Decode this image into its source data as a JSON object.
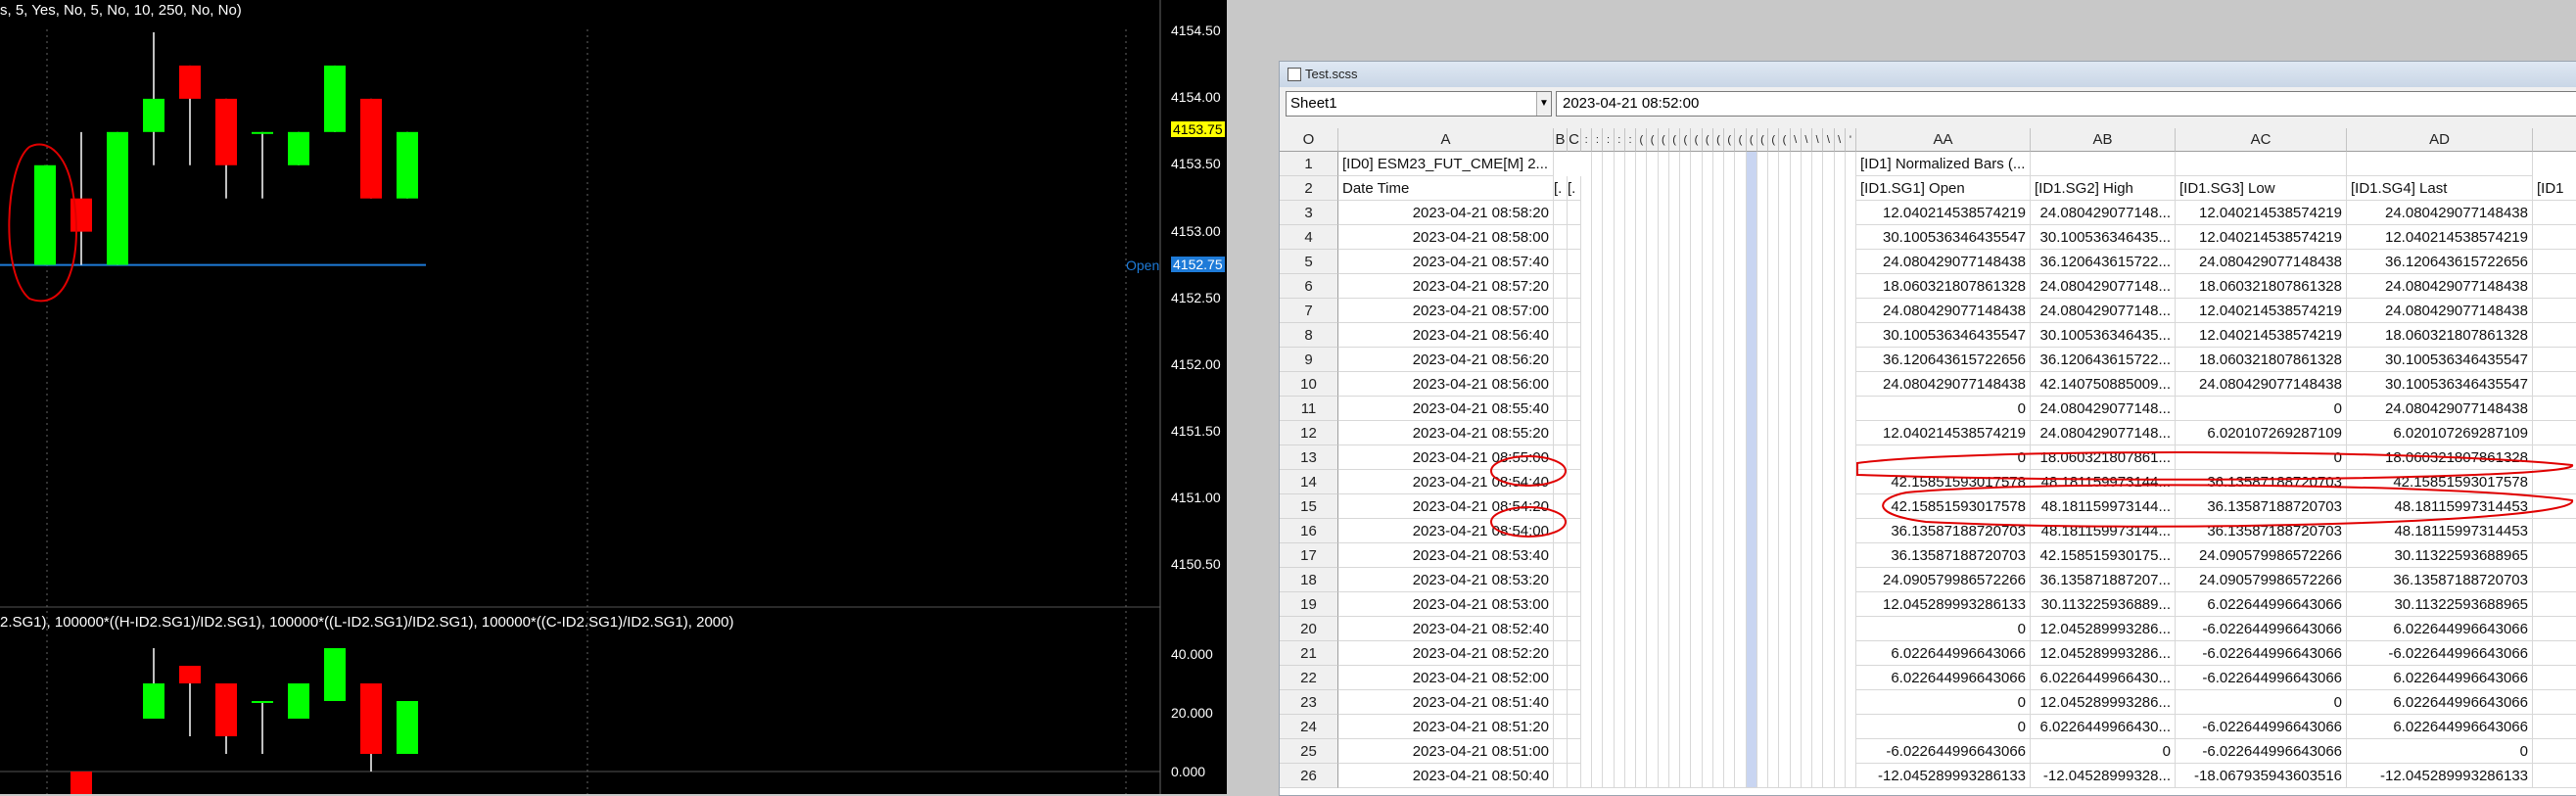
{
  "chart": {
    "study_title": "s, 5, Yes, No, 5, No, 10, 250, No, No)",
    "study2_title": "2.SG1), 100000*((H-ID2.SG1)/ID2.SG1), 100000*((L-ID2.SG1)/ID2.SG1), 100000*((C-ID2.SG1)/ID2.SG1), 2000)",
    "price_axis": [
      "4154.50",
      "4154.00",
      "4153.50",
      "4153.00",
      "4152.50",
      "4152.00",
      "4151.50",
      "4151.00",
      "4150.50"
    ],
    "current_price": "4153.75",
    "open_price": "4152.75",
    "open_label": "Open",
    "study_axis": [
      "40.000",
      "20.000",
      "0.000"
    ],
    "colors": {
      "up": "#00ff00",
      "down": "#ff0000",
      "open_line": "#1e7bd8",
      "highlight": "#ffff00"
    },
    "candles": [
      {
        "o": 4152.75,
        "h": 4153.5,
        "l": 4152.75,
        "c": 4153.5
      },
      {
        "o": 4153.25,
        "h": 4153.75,
        "l": 4152.75,
        "c": 4153.0
      },
      {
        "o": 4152.75,
        "h": 4153.75,
        "l": 4152.75,
        "c": 4153.75
      },
      {
        "o": 4153.75,
        "h": 4154.5,
        "l": 4153.5,
        "c": 4154.0
      },
      {
        "o": 4154.25,
        "h": 4154.25,
        "l": 4153.5,
        "c": 4154.0
      },
      {
        "o": 4154.0,
        "h": 4154.0,
        "l": 4153.25,
        "c": 4153.5
      },
      {
        "o": 4153.75,
        "h": 4153.75,
        "l": 4153.25,
        "c": 4153.75
      },
      {
        "o": 4153.5,
        "h": 4153.75,
        "l": 4153.5,
        "c": 4153.75
      },
      {
        "o": 4153.75,
        "h": 4154.25,
        "l": 4153.75,
        "c": 4154.25
      },
      {
        "o": 4154.0,
        "h": 4154.0,
        "l": 4153.25,
        "c": 4153.25
      },
      {
        "o": 4153.25,
        "h": 4153.75,
        "l": 4153.25,
        "c": 4153.75
      }
    ],
    "study_bars": [
      {
        "o": 0,
        "h": 0,
        "l": 0,
        "c": 0
      },
      {
        "o": 0,
        "h": 0,
        "l": -12,
        "c": -12
      },
      {
        "o": 0,
        "h": 0,
        "l": 0,
        "c": 0
      },
      {
        "o": 18,
        "h": 42,
        "l": 18,
        "c": 30
      },
      {
        "o": 36,
        "h": 36,
        "l": 12,
        "c": 30
      },
      {
        "o": 30,
        "h": 30,
        "l": 6,
        "c": 12
      },
      {
        "o": 24,
        "h": 24,
        "l": 6,
        "c": 24
      },
      {
        "o": 18,
        "h": 18,
        "l": 18,
        "c": 30
      },
      {
        "o": 24,
        "h": 42,
        "l": 24,
        "c": 42
      },
      {
        "o": 30,
        "h": 30,
        "l": 0,
        "c": 6
      },
      {
        "o": 6,
        "h": 24,
        "l": 6,
        "c": 24
      }
    ]
  },
  "sheet": {
    "window_title": "Test.scss",
    "sheet_name": "Sheet1",
    "formula_value": "2023-04-21  08:52:00",
    "corner": "O",
    "columns": {
      "A": "A",
      "B": "B",
      "C": "C",
      "AA": "AA",
      "AB": "AB",
      "AC": "AC",
      "AD": "AD"
    },
    "narrow_cols": [
      ":",
      ":",
      ":",
      ":",
      ":",
      "(",
      "(",
      "(",
      "(",
      "(",
      "(",
      "(",
      "(",
      "(",
      "(",
      "(",
      "(",
      "(",
      "(",
      "\\",
      "\\",
      "\\",
      "\\",
      "\\",
      "'"
    ],
    "row1": {
      "a": "[ID0] ESM23_FUT_CME[M]  2...",
      "b": "",
      "c": "",
      "aa": "[ID1] Normalized Bars (...",
      "ab": "",
      "ac": "",
      "ad": ""
    },
    "row2": {
      "a": "Date Time",
      "b": "[.",
      "c": "[.",
      "aa": "[ID1.SG1] Open",
      "ab": "[ID1.SG2] High",
      "ac": "[ID1.SG3] Low",
      "ad": "[ID1.SG4] Last",
      "ae": "[ID1"
    },
    "rows": [
      {
        "n": "3",
        "dt": "2023-04-21  08:58:20",
        "aa": "12.040214538574219",
        "ab": "24.080429077148...",
        "ac": "12.040214538574219",
        "ad": "24.080429077148438"
      },
      {
        "n": "4",
        "dt": "2023-04-21  08:58:00",
        "aa": "30.100536346435547",
        "ab": "30.100536346435...",
        "ac": "12.040214538574219",
        "ad": "12.040214538574219"
      },
      {
        "n": "5",
        "dt": "2023-04-21  08:57:40",
        "aa": "24.080429077148438",
        "ab": "36.120643615722...",
        "ac": "24.080429077148438",
        "ad": "36.120643615722656"
      },
      {
        "n": "6",
        "dt": "2023-04-21  08:57:20",
        "aa": "18.060321807861328",
        "ab": "24.080429077148...",
        "ac": "18.060321807861328",
        "ad": "24.080429077148438"
      },
      {
        "n": "7",
        "dt": "2023-04-21  08:57:00",
        "aa": "24.080429077148438",
        "ab": "24.080429077148...",
        "ac": "12.040214538574219",
        "ad": "24.080429077148438"
      },
      {
        "n": "8",
        "dt": "2023-04-21  08:56:40",
        "aa": "30.100536346435547",
        "ab": "30.100536346435...",
        "ac": "12.040214538574219",
        "ad": "18.060321807861328"
      },
      {
        "n": "9",
        "dt": "2023-04-21  08:56:20",
        "aa": "36.120643615722656",
        "ab": "36.120643615722...",
        "ac": "18.060321807861328",
        "ad": "30.100536346435547"
      },
      {
        "n": "10",
        "dt": "2023-04-21  08:56:00",
        "aa": "24.080429077148438",
        "ab": "42.140750885009...",
        "ac": "24.080429077148438",
        "ad": "30.100536346435547"
      },
      {
        "n": "11",
        "dt": "2023-04-21  08:55:40",
        "aa": "0",
        "ab": "24.080429077148...",
        "ac": "0",
        "ad": "24.080429077148438"
      },
      {
        "n": "12",
        "dt": "2023-04-21  08:55:20",
        "aa": "12.040214538574219",
        "ab": "24.080429077148...",
        "ac": "6.0201072692871​09",
        "ad": "6.020107269287109"
      },
      {
        "n": "13",
        "dt": "2023-04-21  08:55:00",
        "aa": "0",
        "ab": "18.060321807861...",
        "ac": "0",
        "ad": "18.060321807861328"
      },
      {
        "n": "14",
        "dt": "2023-04-21  08:54:40",
        "aa": "42.15851593017578",
        "ab": "48.181159973144...",
        "ac": "36.13587188720703",
        "ad": "42.15851593017578"
      },
      {
        "n": "15",
        "dt": "2023-04-21  08:54:20",
        "aa": "42.15851593017578",
        "ab": "48.181159973144...",
        "ac": "36.13587188720703",
        "ad": "48.18115997314453"
      },
      {
        "n": "16",
        "dt": "2023-04-21  08:54:00",
        "aa": "36.13587188720703",
        "ab": "48.181159973144...",
        "ac": "36.13587188720703",
        "ad": "48.18115997314453"
      },
      {
        "n": "17",
        "dt": "2023-04-21  08:53:40",
        "aa": "36.13587188720703",
        "ab": "42.158515930175...",
        "ac": "24.090579986572266",
        "ad": "30.11322593688965"
      },
      {
        "n": "18",
        "dt": "2023-04-21  08:53:20",
        "aa": "24.090579986572266",
        "ab": "36.135871887207...",
        "ac": "24.090579986572266",
        "ad": "36.13587188720703"
      },
      {
        "n": "19",
        "dt": "2023-04-21  08:53:00",
        "aa": "12.045289993286133",
        "ab": "30.113225936889...",
        "ac": "6.022644996643066",
        "ad": "30.11322593688965"
      },
      {
        "n": "20",
        "dt": "2023-04-21  08:52:40",
        "aa": "0",
        "ab": "12.045289993286...",
        "ac": "-6.022644996643066",
        "ad": "6.022644996643066"
      },
      {
        "n": "21",
        "dt": "2023-04-21  08:52:20",
        "aa": "6.022644996643066",
        "ab": "12.045289993286...",
        "ac": "-6.022644996643066",
        "ad": "-6.022644996643066"
      },
      {
        "n": "22",
        "dt": "2023-04-21  08:52:00",
        "aa": "6.022644996643066",
        "ab": "6.0226449966430...",
        "ac": "-6.022644996643066",
        "ad": "6.022644996643066"
      },
      {
        "n": "23",
        "dt": "2023-04-21  08:51:40",
        "aa": "0",
        "ab": "12.045289993286...",
        "ac": "0",
        "ad": "6.022644996643066"
      },
      {
        "n": "24",
        "dt": "2023-04-21  08:51:20",
        "aa": "0",
        "ab": "6.0226449966430...",
        "ac": "-6.022644996643066",
        "ad": "6.022644996643066"
      },
      {
        "n": "25",
        "dt": "2023-04-21  08:51:00",
        "aa": "-6.022644996643066",
        "ab": "0",
        "ac": "-6.022644996643066",
        "ad": "0"
      },
      {
        "n": "26",
        "dt": "2023-04-21  08:50:40",
        "aa": "-12.045289993286133",
        "ab": "-12.04528999328...",
        "ac": "-18.067935943603516",
        "ad": "-12.045289993286133"
      }
    ]
  }
}
